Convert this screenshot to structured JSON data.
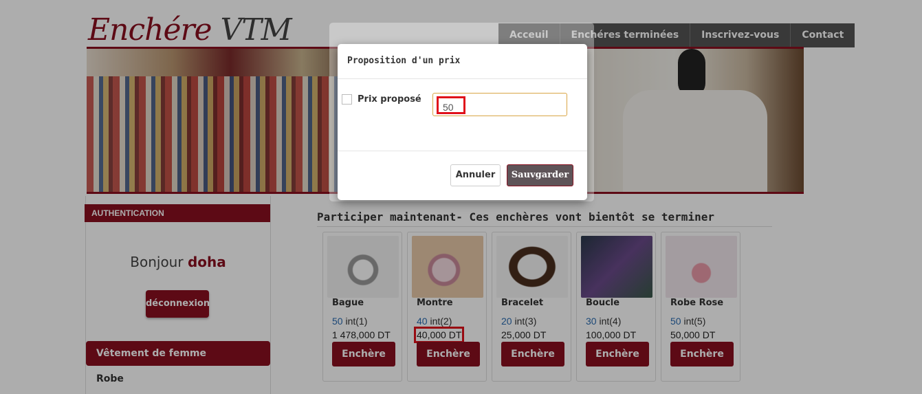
{
  "site": {
    "logo_main": "Enchére",
    "logo_accent": " VTM"
  },
  "nav": {
    "items": [
      "Acceuil",
      "Enchéres terminées",
      "Inscrivez-vous",
      "Contact"
    ]
  },
  "sidebar": {
    "auth_title": "AUTHENTICATION",
    "greeting": "Bonjour",
    "username": "doha",
    "logout_label": "déconnexion",
    "category_title": "Vêtement de femme",
    "category_item": "Robe"
  },
  "main": {
    "title": "Participer maintenant- Ces enchères vont bientôt se terminer",
    "products": [
      {
        "name": "Bague",
        "bid_count": "50",
        "bid_label": "int(1)",
        "price": "1 478,000 DT",
        "button": "Enchère",
        "thumb_colors": [
          "#f2f2f2",
          "#9a9a9a"
        ]
      },
      {
        "name": "Montre",
        "bid_count": "40",
        "bid_label": "int(2)",
        "price": "40,000 DT",
        "button": "Enchère",
        "thumb_colors": [
          "#e8c9a8",
          "#c98a9a"
        ]
      },
      {
        "name": "Bracelet",
        "bid_count": "20",
        "bid_label": "int(3)",
        "price": "25,000 DT",
        "button": "Enchère",
        "thumb_colors": [
          "#f5f5f5",
          "#4a2e1e"
        ]
      },
      {
        "name": "Boucle",
        "bid_count": "30",
        "bid_label": "int(4)",
        "price": "100,000 DT",
        "button": "Enchère",
        "thumb_colors": [
          "#2a3a4a",
          "#6a4a8a"
        ]
      },
      {
        "name": "Robe Rose",
        "bid_count": "50",
        "bid_label": "int(5)",
        "price": "50,000 DT",
        "button": "Enchère",
        "thumb_colors": [
          "#f0e6ec",
          "#e99aa8"
        ]
      }
    ]
  },
  "modal": {
    "title": "Proposition d'un prix",
    "field_label": "Prix proposé",
    "field_value": "50",
    "cancel_label": "Annuler",
    "save_label": "Sauvgarder"
  },
  "colors": {
    "brand": "#8a1020",
    "nav_bg": "#555555",
    "link": "#2a6bb0",
    "highlight": "#e0101a"
  }
}
